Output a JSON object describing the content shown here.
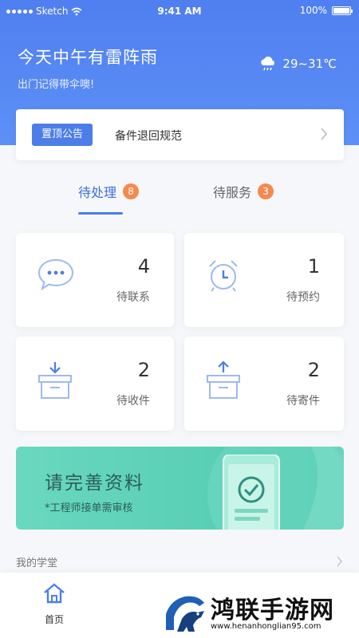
{
  "statusbar": {
    "carrier": "Sketch",
    "time": "9:41 AM",
    "battery": "100%"
  },
  "weather": {
    "title": "今天中午有雷阵雨",
    "subtitle": "出门记得带伞噢!",
    "temp": "29~31℃",
    "icon": "cloud-rain-icon"
  },
  "notice": {
    "tag": "置顶公告",
    "text": "备件退回规范"
  },
  "tabs": [
    {
      "label": "待处理",
      "badge": "8",
      "active": true
    },
    {
      "label": "待服务",
      "badge": "3",
      "active": false
    }
  ],
  "stats": [
    {
      "label": "待联系",
      "value": "4",
      "icon": "chat-bubble-icon"
    },
    {
      "label": "待预约",
      "value": "1",
      "icon": "alarm-clock-icon"
    },
    {
      "label": "待收件",
      "value": "2",
      "icon": "inbox-download-icon"
    },
    {
      "label": "待寄件",
      "value": "2",
      "icon": "outbox-upload-icon"
    }
  ],
  "banner": {
    "title": "请完善资料",
    "subtitle": "*工程师接单需审核"
  },
  "school": {
    "label": "我的学堂"
  },
  "nav": {
    "home_label": "首页"
  },
  "watermark": {
    "text": "鸿联手游网",
    "url": "www.henanhonglian95.com"
  },
  "colors": {
    "primary": "#4d7de9",
    "badge": "#f58a4f",
    "banner": "#5ccfb6"
  }
}
